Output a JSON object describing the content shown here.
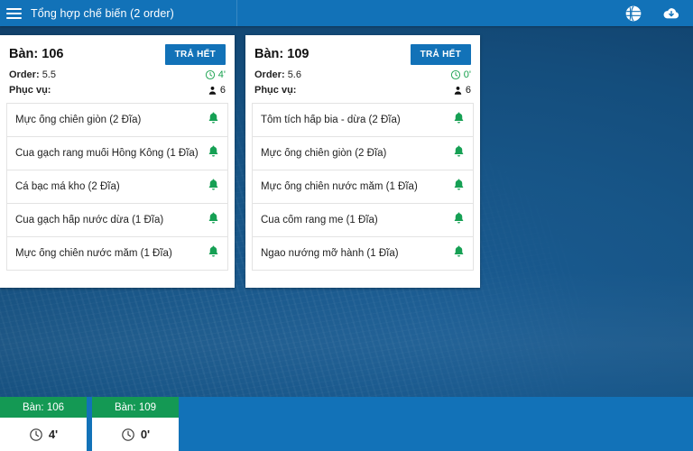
{
  "appbar": {
    "menu_icon": "hamburger-menu-icon",
    "title": "Tổng hợp chế biến (2 order)",
    "actions": [
      {
        "icon": "globe-icon",
        "name": "language-globe"
      },
      {
        "icon": "cloud-download-icon",
        "name": "cloud-download"
      }
    ]
  },
  "colors": {
    "appbar_blue": "#1272b8",
    "background_blue": "#14497c",
    "green": "#149954",
    "time_green": "#15a04c",
    "bell_green": "#16a054"
  },
  "orders": [
    {
      "table_label": "Bàn: 106",
      "pay_all_label": "TRẢ HẾT",
      "order_label": "Order:",
      "order_value": "5.5",
      "serve_label": "Phục vụ:",
      "time_icon": "clock-icon",
      "time_value": "4'",
      "guest_icon": "person-icon",
      "guest_value": "6",
      "dishes": [
        {
          "name": "Mực ống chiên giòn (2 Đĩa)",
          "icon": "bell-icon"
        },
        {
          "name": "Cua gạch rang muối Hồng Kông (1 Đĩa)",
          "icon": "bell-icon"
        },
        {
          "name": "Cá bạc má kho (2 Đĩa)",
          "icon": "bell-icon"
        },
        {
          "name": "Cua gạch hấp nước dừa (1 Đĩa)",
          "icon": "bell-icon"
        },
        {
          "name": "Mực ống chiên nước mắm (1 Đĩa)",
          "icon": "bell-icon"
        }
      ]
    },
    {
      "table_label": "Bàn: 109",
      "pay_all_label": "TRẢ HẾT",
      "order_label": "Order:",
      "order_value": "5.6",
      "serve_label": "Phục vụ:",
      "time_icon": "clock-icon",
      "time_value": "0'",
      "guest_icon": "person-icon",
      "guest_value": "6",
      "dishes": [
        {
          "name": "Tôm tích hấp bia - dừa (2 Đĩa)",
          "icon": "bell-icon"
        },
        {
          "name": "Mực ống chiên giòn (2 Đĩa)",
          "icon": "bell-icon"
        },
        {
          "name": "Mực ống chiên nước mắm (1 Đĩa)",
          "icon": "bell-icon"
        },
        {
          "name": "Cua cốm rang me (1 Đĩa)",
          "icon": "bell-icon"
        },
        {
          "name": "Ngao nướng mỡ hành (1 Đĩa)",
          "icon": "bell-icon"
        }
      ]
    }
  ],
  "bottom_bar": {
    "tiles": [
      {
        "table_label": "Bàn: 106",
        "time_icon": "clock-icon",
        "time_value": "4'"
      },
      {
        "table_label": "Bàn: 109",
        "time_icon": "clock-icon",
        "time_value": "0'"
      }
    ]
  }
}
